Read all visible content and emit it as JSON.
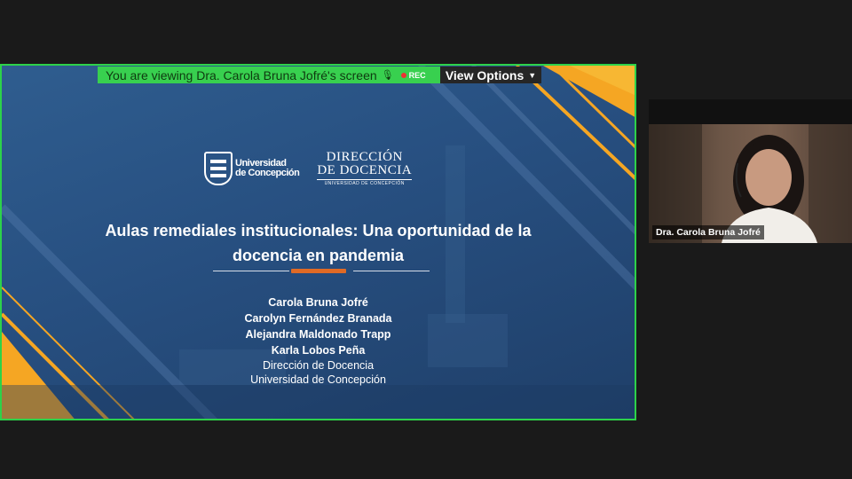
{
  "share_banner": {
    "viewing_text": "You are viewing Dra. Carola Bruna Jofré's screen",
    "rec_label": "REC",
    "view_options_label": "View Options"
  },
  "slide": {
    "logo_left": {
      "line1": "Universidad",
      "line2": "de Concepción"
    },
    "logo_right": {
      "line1": "DIRECCIÓN",
      "line2": "DE DOCENCIA",
      "sub": "UNIVERSIDAD DE CONCEPCIÓN"
    },
    "title_line1": "Aulas remediales institucionales: Una oportunidad de la",
    "title_line2": "docencia en pandemia",
    "authors": [
      "Carola Bruna Jofré",
      "Carolyn Fernández Branada",
      "Alejandra Maldonado Trapp",
      "Karla Lobos Peña"
    ],
    "affiliation_line1": "Dirección de Docencia",
    "affiliation_line2": "Universidad de Concepción"
  },
  "participant": {
    "name": "Dra. Carola Bruna Jofré"
  },
  "colors": {
    "share_border": "#2dd24a",
    "slide_bg": "#2a568a",
    "accent_orange": "#f5a623",
    "divider_orange": "#e06a25"
  }
}
